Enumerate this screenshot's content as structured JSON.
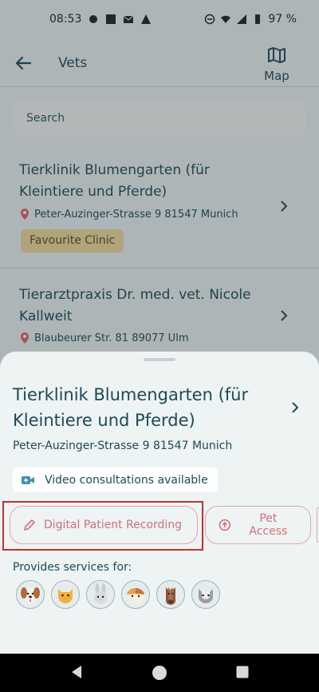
{
  "status_bar": {
    "time": "08:53",
    "battery": "97 %"
  },
  "app_bar": {
    "title": "Vets",
    "map_label": "Map"
  },
  "search": {
    "placeholder": "Search"
  },
  "list": {
    "items": [
      {
        "title": "Tierklinik Blumengarten (für Kleintiere und Pferde)",
        "address": "Peter-Auzinger-Strasse 9 81547 Munich",
        "badge": "Favourite Clinic"
      },
      {
        "title": "Tierarztpraxis Dr. med. vet. Nicole Kallweit",
        "address": "Blaubeurer Str. 81 89077 Ulm"
      }
    ]
  },
  "sheet": {
    "title": "Tierklinik Blumengarten (für Kleintiere und Pferde)",
    "address": "Peter-Auzinger-Strasse 9 81547 Munich",
    "video_chip": "Video consultations available",
    "buttons": {
      "digital_recording": "Digital Patient Recording",
      "pet_access": "Pet Access"
    },
    "services_label": "Provides services for:",
    "pets": [
      "dog",
      "cat",
      "rabbit",
      "guinea-pig",
      "horse",
      "other-cat"
    ]
  },
  "colors": {
    "accent": "#d2707a",
    "text": "#1d4a57",
    "badge": "#f2d99a",
    "highlight": "#c0322e"
  }
}
